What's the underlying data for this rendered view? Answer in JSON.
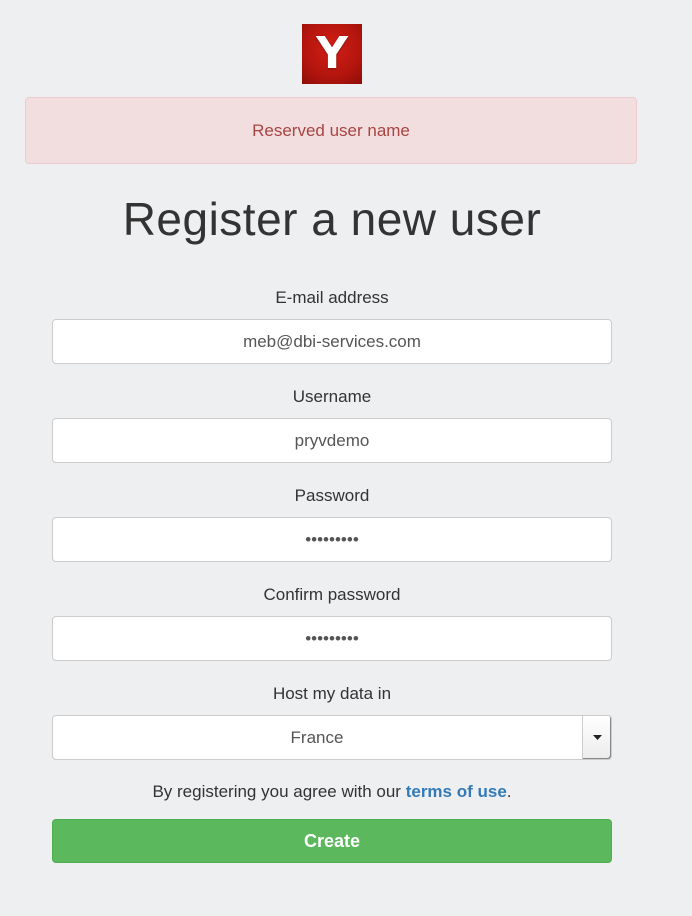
{
  "logo": {
    "letter": "Y",
    "icon": "y-logo-icon",
    "color": "#c0180f"
  },
  "alert": {
    "message": "Reserved user name",
    "color": "#a94442",
    "background": "#f2dede"
  },
  "page_title": "Register a new user",
  "form": {
    "email": {
      "label": "E-mail address",
      "value": "meb@dbi-services.com"
    },
    "username": {
      "label": "Username",
      "value": "pryvdemo"
    },
    "password": {
      "label": "Password",
      "value": "•••••••••"
    },
    "confirm_password": {
      "label": "Confirm password",
      "value": "•••••••••"
    },
    "host": {
      "label": "Host my data in",
      "selected": "France",
      "icon": "chevron-down-icon"
    }
  },
  "terms": {
    "prefix": "By registering you agree with our ",
    "link": "terms of use",
    "suffix": ".",
    "link_color": "#337ab7"
  },
  "create_button": {
    "label": "Create",
    "color": "#5cb85c"
  }
}
